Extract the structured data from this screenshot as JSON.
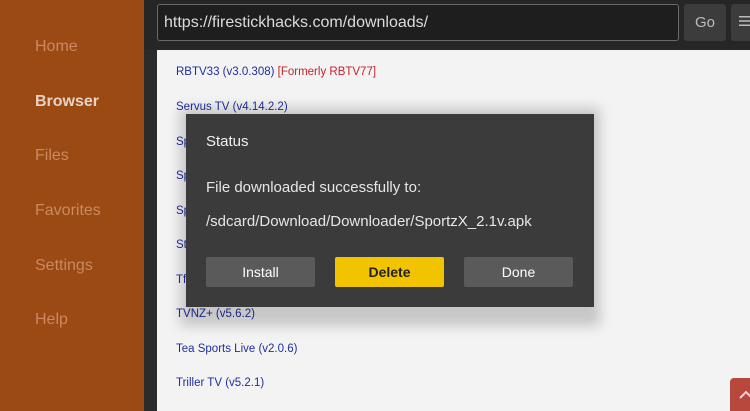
{
  "sidebar": {
    "items": [
      {
        "label": "Home",
        "active": false
      },
      {
        "label": "Browser",
        "active": true
      },
      {
        "label": "Files",
        "active": false
      },
      {
        "label": "Favorites",
        "active": false
      },
      {
        "label": "Settings",
        "active": false
      },
      {
        "label": "Help",
        "active": false
      }
    ]
  },
  "topbar": {
    "url": "https://firestickhacks.com/downloads/",
    "go_label": "Go",
    "menu_icon": "menu-icon"
  },
  "content": {
    "links": [
      {
        "text": "RBTV33 (v3.0.308)",
        "note": "[Formerly RBTV77]"
      },
      {
        "text": "Servus TV (v4.14.2.2)",
        "note": ""
      },
      {
        "text": "Sp",
        "note": ""
      },
      {
        "text": "Sp",
        "note": ""
      },
      {
        "text": "Sp",
        "note": ""
      },
      {
        "text": "St",
        "note": ""
      },
      {
        "text": "Tf",
        "note": ""
      },
      {
        "text": "TVNZ+ (v5.6.2)",
        "note": ""
      },
      {
        "text": "Tea Sports Live (v2.0.6)",
        "note": ""
      },
      {
        "text": "Triller TV (v5.2.1)",
        "note": ""
      }
    ]
  },
  "dialog": {
    "title": "Status",
    "message": "File downloaded successfully to:",
    "path": "/sdcard/Download/Downloader/SportzX_2.1v.apk",
    "buttons": {
      "install": "Install",
      "delete": "Delete",
      "done": "Done"
    }
  },
  "colors": {
    "sidebar": "#9a4a12",
    "accent": "#f2c400",
    "dialog": "#3b3b3b",
    "link": "#1e2fa0",
    "note": "#c0242a"
  }
}
